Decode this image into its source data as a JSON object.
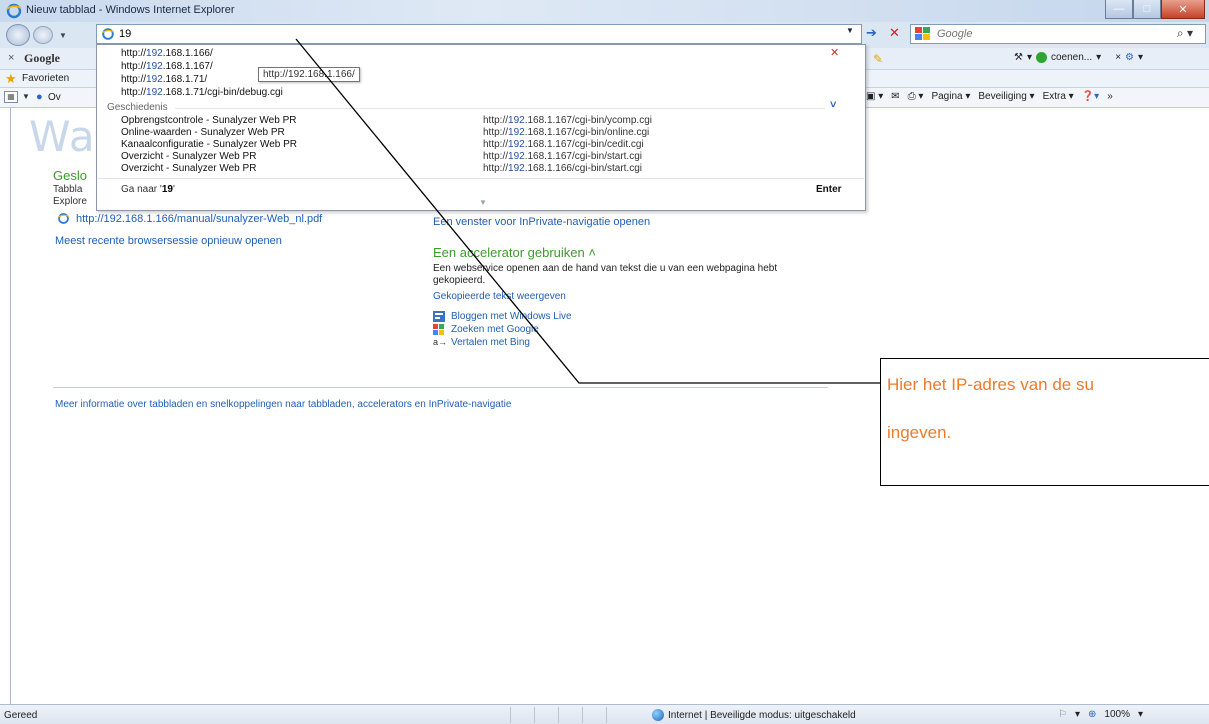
{
  "window": {
    "title": "Nieuw tabblad - Windows Internet Explorer",
    "controls": {
      "minimize": "—",
      "maximize": "□",
      "close": "✕"
    }
  },
  "address_bar": {
    "value": "19",
    "dropdown": "▼",
    "go": "➔",
    "stop": "✕"
  },
  "search": {
    "placeholder": "Google",
    "go": "⌕ ▾"
  },
  "google_toolbar": {
    "close": "×",
    "label": "Google",
    "user": "coenen...",
    "dropdown": "▾",
    "close_right": "×"
  },
  "favorites": {
    "label": "Favorieten"
  },
  "command_bar": {
    "tab_label": "Ov",
    "items": [
      "Pagina ▾",
      "Beveiliging ▾",
      "Extra ▾"
    ],
    "more": "»"
  },
  "autocomplete": {
    "suggestions": [
      {
        "prefix": "http://",
        "match": "192",
        "rest": ".168.1.166/"
      },
      {
        "prefix": "http://",
        "match": "192",
        "rest": ".168.1.167/"
      },
      {
        "prefix": "http://",
        "match": "192",
        "rest": ".168.1.71/"
      },
      {
        "prefix": "http://",
        "match": "192",
        "rest": ".168.1.71/cgi-bin/debug.cgi"
      }
    ],
    "tooltip": "http://192.168.1.166/",
    "close": "✕",
    "history_header": "Geschiedenis",
    "history": [
      {
        "title": "Opbrengstcontrole - Sunalyzer Web PR",
        "url_prefix": "http://",
        "url_match": "192",
        "url_rest": ".168.1.167/cgi-bin/ycomp.cgi"
      },
      {
        "title": "Online-waarden - Sunalyzer Web PR",
        "url_prefix": "http://",
        "url_match": "192",
        "url_rest": ".168.1.167/cgi-bin/online.cgi"
      },
      {
        "title": "Kanaalconfiguratie - Sunalyzer Web PR",
        "url_prefix": "http://",
        "url_match": "192",
        "url_rest": ".168.1.167/cgi-bin/cedit.cgi"
      },
      {
        "title": "Overzicht - Sunalyzer Web PR",
        "url_prefix": "http://",
        "url_match": "192",
        "url_rest": ".168.1.167/cgi-bin/start.cgi"
      },
      {
        "title": "Overzicht - Sunalyzer Web PR",
        "url_prefix": "http://",
        "url_match": "192",
        "url_rest": ".168.1.166/cgi-bin/start.cgi"
      }
    ],
    "goto_prefix": "Ga naar '",
    "goto_value": "19",
    "goto_suffix": "'",
    "enter": "Enter",
    "chevron": "˅"
  },
  "page": {
    "welcome_title": "Wa",
    "closed_tabs_title": "Geslo",
    "closed_tabs_desc": "Tabbla Explore",
    "pdf_link": "http://192.168.1.166/manual/sunalyzer-Web_nl.pdf",
    "restore_session": "Meest recente browsersessie opnieuw openen",
    "inprivate_link": "Een venster voor InPrivate-navigatie openen",
    "accelerator_title": "Een accelerator gebruiken ˄",
    "accelerator_desc": "Een webservice openen aan de hand van tekst die u van een webpagina hebt gekopieerd.",
    "copied_text_link": "Gekopieerde tekst weergeven",
    "accelerators": [
      {
        "label": "Bloggen met Windows Live",
        "icon": "windows-live-icon"
      },
      {
        "label": "Zoeken met Google",
        "icon": "google-icon"
      },
      {
        "label": "Vertalen met Bing",
        "icon": "translate-icon"
      }
    ],
    "more_info": "Meer informatie over tabbladen en snelkoppelingen naar tabbladen, accelerators en InPrivate-navigatie"
  },
  "callout": {
    "line1": "Hier het IP-adres van de su",
    "line2": "ingeven."
  },
  "status_bar": {
    "status": "Gereed",
    "zone": "Internet | Beveiligde modus: uitgeschakeld",
    "zoom": "100%",
    "zoom_prefix": "⊕",
    "dropdown": "▾"
  },
  "colors": {
    "link": "#1f5fb6",
    "heading_green": "#3a9d2a",
    "callout_orange": "#ec7b2c"
  }
}
